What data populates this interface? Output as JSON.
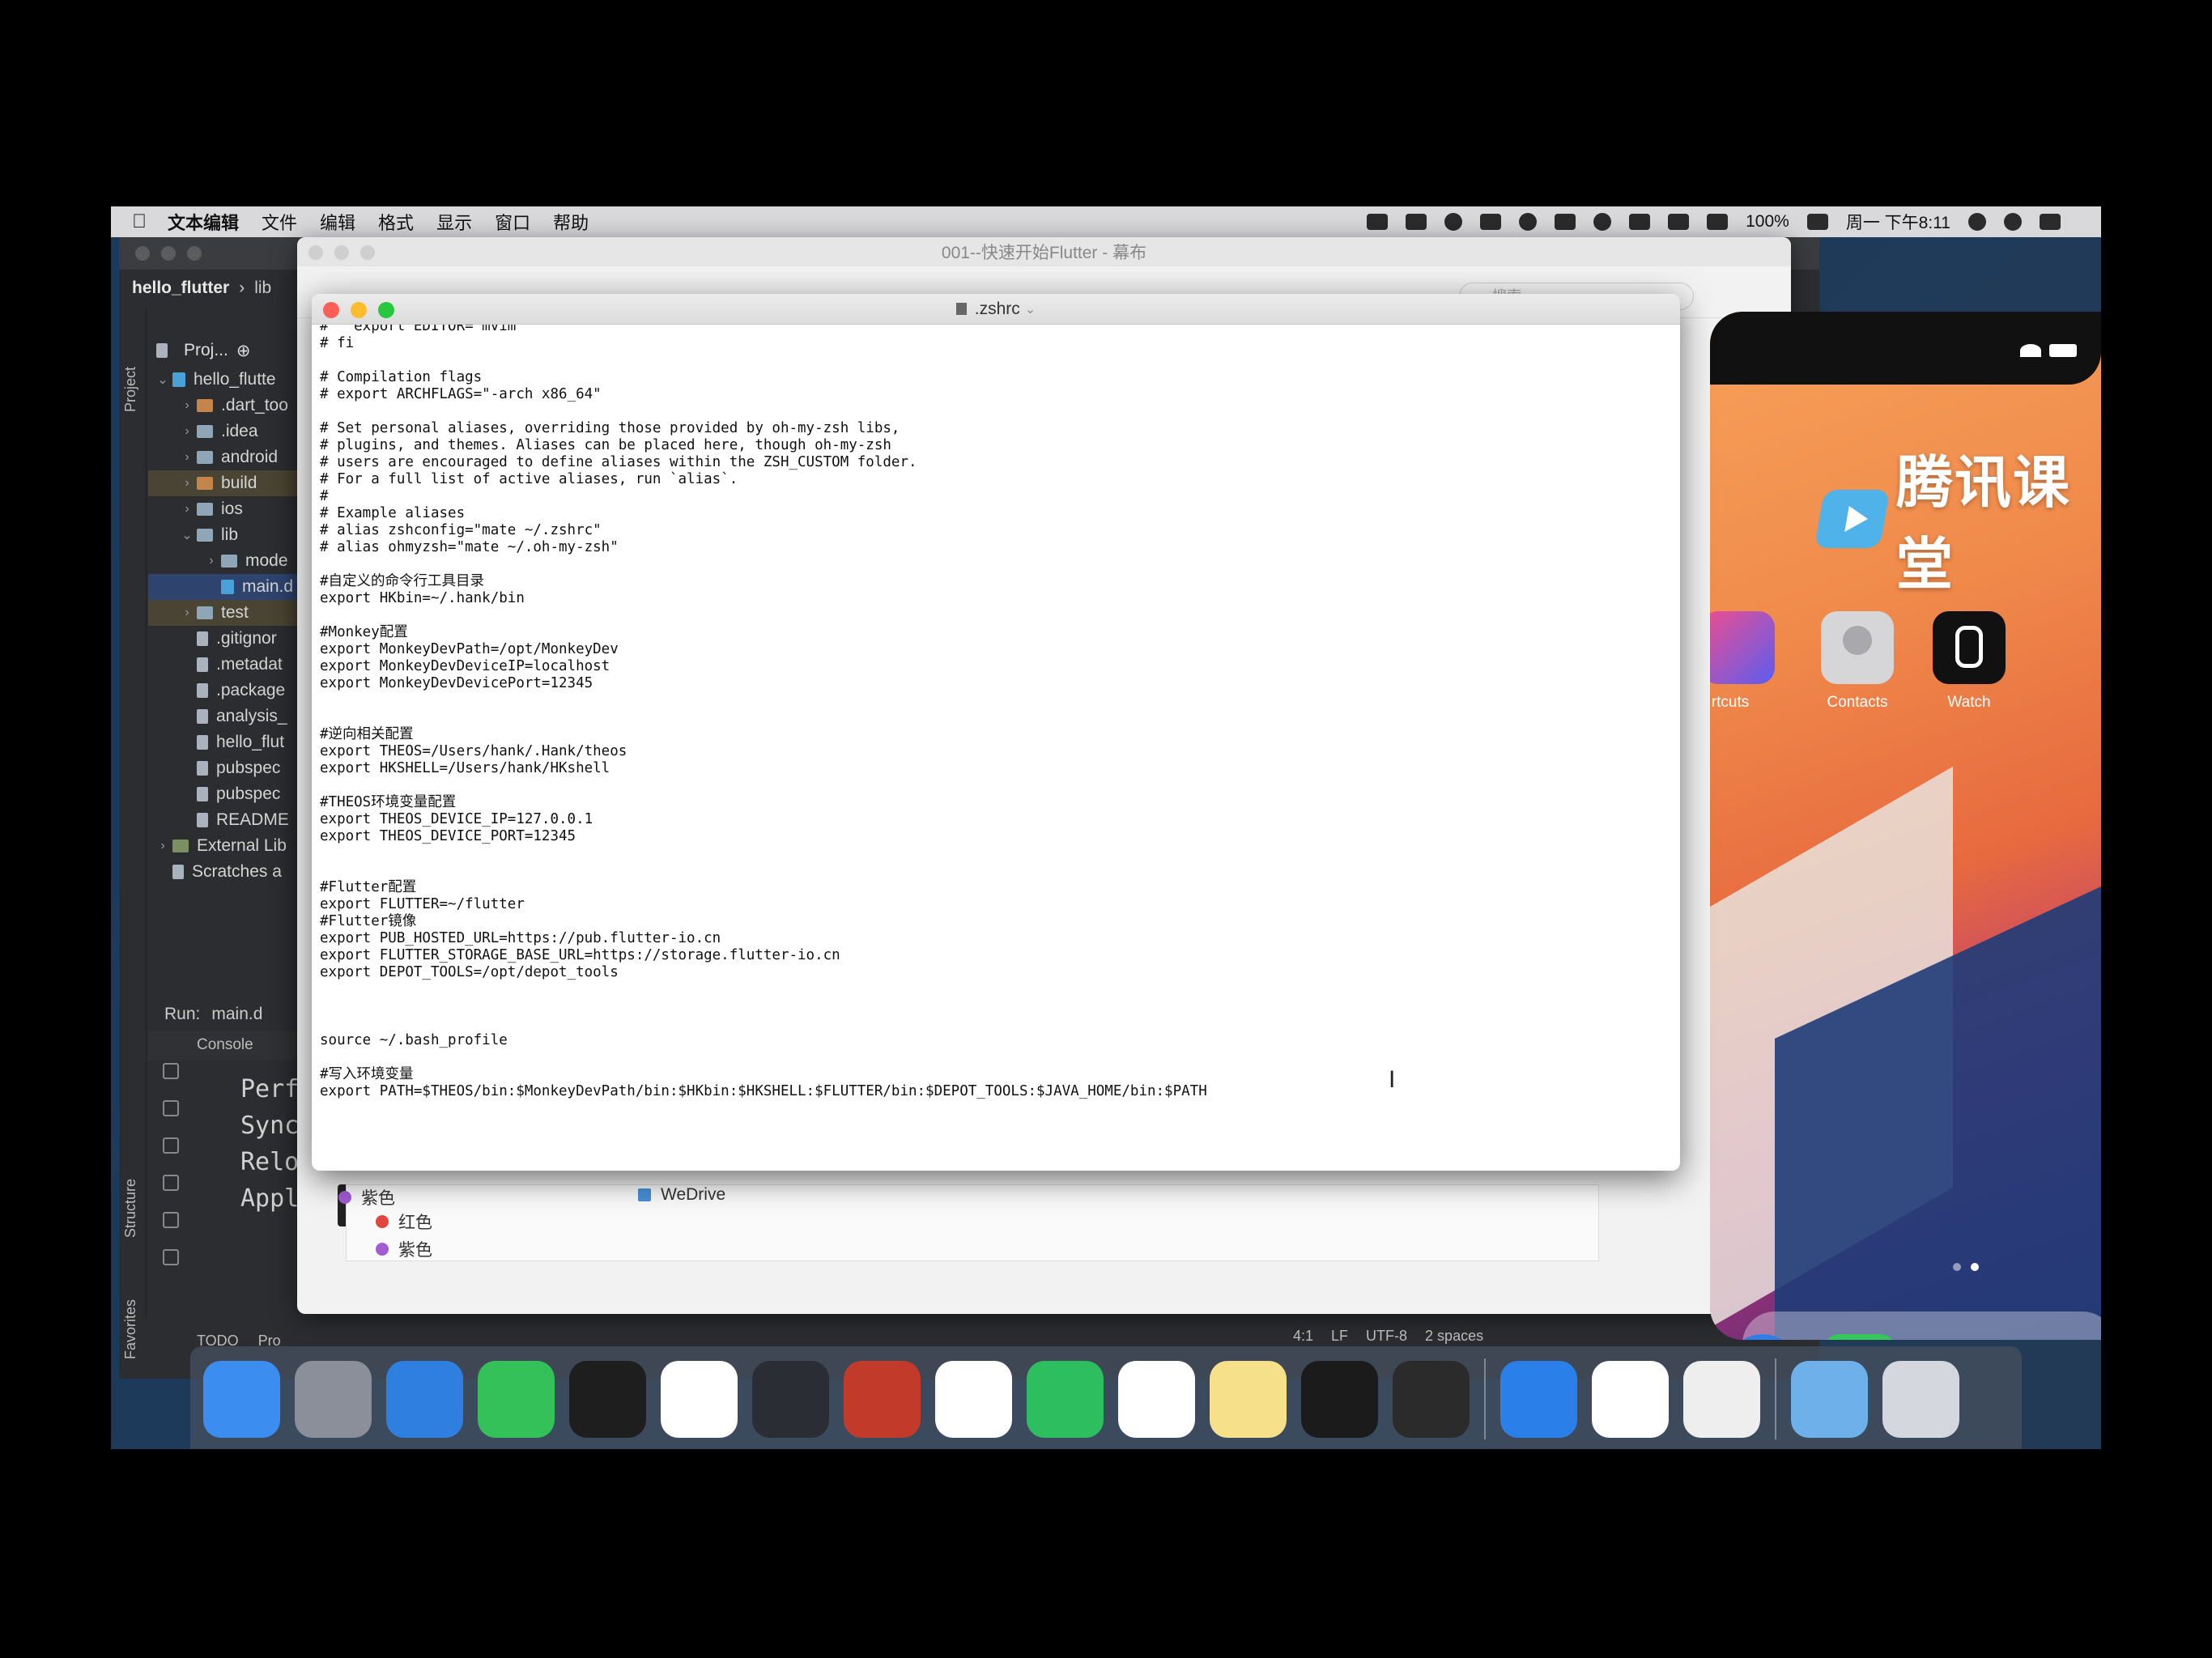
{
  "menubar": {
    "app": "文本编辑",
    "items": [
      "文件",
      "编辑",
      "格式",
      "显示",
      "窗口",
      "帮助"
    ],
    "battery": "100%",
    "clock": "周一 下午8:11"
  },
  "ide": {
    "project": "hello_flutter",
    "crumb": "lib",
    "project_tab": "Project",
    "project_view": "Proj...",
    "tree": [
      {
        "label": "hello_flutte",
        "indent": 0,
        "caret": "v",
        "icon": "dart"
      },
      {
        "label": ".dart_too",
        "indent": 1,
        "caret": ">",
        "icon": "folder-orange"
      },
      {
        "label": ".idea",
        "indent": 1,
        "caret": ">",
        "icon": "folder"
      },
      {
        "label": "android",
        "indent": 1,
        "caret": ">",
        "icon": "folder"
      },
      {
        "label": "build",
        "indent": 1,
        "caret": ">",
        "icon": "folder-orange",
        "state": "mod"
      },
      {
        "label": "ios",
        "indent": 1,
        "caret": ">",
        "icon": "folder"
      },
      {
        "label": "lib",
        "indent": 1,
        "caret": "v",
        "icon": "folder"
      },
      {
        "label": "mode",
        "indent": 2,
        "caret": ">",
        "icon": "folder"
      },
      {
        "label": "main.d",
        "indent": 2,
        "caret": "",
        "icon": "dart",
        "state": "sel"
      },
      {
        "label": "test",
        "indent": 1,
        "caret": ">",
        "icon": "folder",
        "state": "mod"
      },
      {
        "label": ".gitignor",
        "indent": 1,
        "caret": "",
        "icon": "file"
      },
      {
        "label": ".metadat",
        "indent": 1,
        "caret": "",
        "icon": "file"
      },
      {
        "label": ".package",
        "indent": 1,
        "caret": "",
        "icon": "file"
      },
      {
        "label": "analysis_",
        "indent": 1,
        "caret": "",
        "icon": "file"
      },
      {
        "label": "hello_flut",
        "indent": 1,
        "caret": "",
        "icon": "file"
      },
      {
        "label": "pubspec",
        "indent": 1,
        "caret": "",
        "icon": "file"
      },
      {
        "label": "pubspec",
        "indent": 1,
        "caret": "",
        "icon": "file"
      },
      {
        "label": "README",
        "indent": 1,
        "caret": "",
        "icon": "file"
      },
      {
        "label": "External Lib",
        "indent": 0,
        "caret": ">",
        "icon": "lib"
      },
      {
        "label": "Scratches a",
        "indent": 0,
        "caret": "",
        "icon": "file"
      }
    ],
    "run_label": "Run:",
    "run_target": "main.d",
    "console_tab": "Console",
    "console_lines": [
      "Perf",
      "Sync",
      "Relo",
      "Appl"
    ],
    "structure_tab": "Structure",
    "favorites_tab": "Favorites",
    "todo_tab": "TODO",
    "problems_tab": "Pro",
    "status": [
      "4:1",
      "LF",
      "UTF-8",
      "2 spaces"
    ]
  },
  "screencast": {
    "title": "001--快速开始Flutter - 幕布",
    "search_placeholder": "搜索",
    "tags": [
      "紫色",
      "红色",
      "紫色"
    ],
    "folder": "WeDrive"
  },
  "textedit": {
    "title": ".zshrc",
    "lines": [
      "#   export EDITOR='mvim'",
      "# fi",
      "",
      "# Compilation flags",
      "# export ARCHFLAGS=\"-arch x86_64\"",
      "",
      "# Set personal aliases, overriding those provided by oh-my-zsh libs,",
      "# plugins, and themes. Aliases can be placed here, though oh-my-zsh",
      "# users are encouraged to define aliases within the ZSH_CUSTOM folder.",
      "# For a full list of active aliases, run `alias`.",
      "#",
      "# Example aliases",
      "# alias zshconfig=\"mate ~/.zshrc\"",
      "# alias ohmyzsh=\"mate ~/.oh-my-zsh\"",
      "",
      "#自定义的命令行工具目录",
      "export HKbin=~/.hank/bin",
      "",
      "#Monkey配置",
      "export MonkeyDevPath=/opt/MonkeyDev",
      "export MonkeyDevDeviceIP=localhost",
      "export MonkeyDevDevicePort=12345",
      "",
      "",
      "#逆向相关配置",
      "export THEOS=/Users/hank/.Hank/theos",
      "export HKSHELL=/Users/hank/HKshell",
      "",
      "#THEOS环境变量配置",
      "export THEOS_DEVICE_IP=127.0.0.1",
      "export THEOS_DEVICE_PORT=12345",
      "",
      "",
      "#Flutter配置",
      "export FLUTTER=~/flutter",
      "#Flutter镜像",
      "export PUB_HOSTED_URL=https://pub.flutter-io.cn",
      "export FLUTTER_STORAGE_BASE_URL=https://storage.flutter-io.cn",
      "export DEPOT_TOOLS=/opt/depot_tools",
      "",
      "",
      "",
      "source ~/.bash_profile",
      "",
      "#写入环境变量",
      "export PATH=$THEOS/bin:$MonkeyDevPath/bin:$HKbin:$HKSHELL:$FLUTTER/bin:$DEPOT_TOOLS:$JAVA_HOME/bin:$PATH"
    ]
  },
  "simulator": {
    "apps": [
      "rtcuts",
      "Contacts",
      "Watch"
    ]
  },
  "watermark": "腾讯课堂",
  "dock": [
    {
      "name": "finder-icon",
      "color": "#3b8ef0"
    },
    {
      "name": "launchpad-icon",
      "color": "#8a8f99"
    },
    {
      "name": "xcode-icon",
      "color": "#2f7fe0"
    },
    {
      "name": "wechat-icon",
      "color": "#34c15a"
    },
    {
      "name": "qq-icon",
      "color": "#1e1e1e"
    },
    {
      "name": "dingtalk-icon",
      "color": "#ffffff"
    },
    {
      "name": "sublime-icon",
      "color": "#2a2d33"
    },
    {
      "name": "reveal-icon",
      "color": "#c23a2a"
    },
    {
      "name": "chrome-icon",
      "color": "#ffffff"
    },
    {
      "name": "evernote-icon",
      "color": "#2dbe60"
    },
    {
      "name": "instruments-icon",
      "color": "#ffffff"
    },
    {
      "name": "stickies-icon",
      "color": "#f6e08a"
    },
    {
      "name": "terminal-icon",
      "color": "#1b1b1b"
    },
    {
      "name": "screencast-icon",
      "color": "#2b2b2b"
    },
    {
      "name": "appstore-icon",
      "color": "#2b7fe8"
    },
    {
      "name": "sourcetree-icon",
      "color": "#ffffff"
    },
    {
      "name": "textedit-icon",
      "color": "#eeeeee"
    },
    {
      "name": "downloads-folder-icon",
      "color": "#6eb1ea"
    },
    {
      "name": "trash-icon",
      "color": "#d4d8de"
    }
  ]
}
